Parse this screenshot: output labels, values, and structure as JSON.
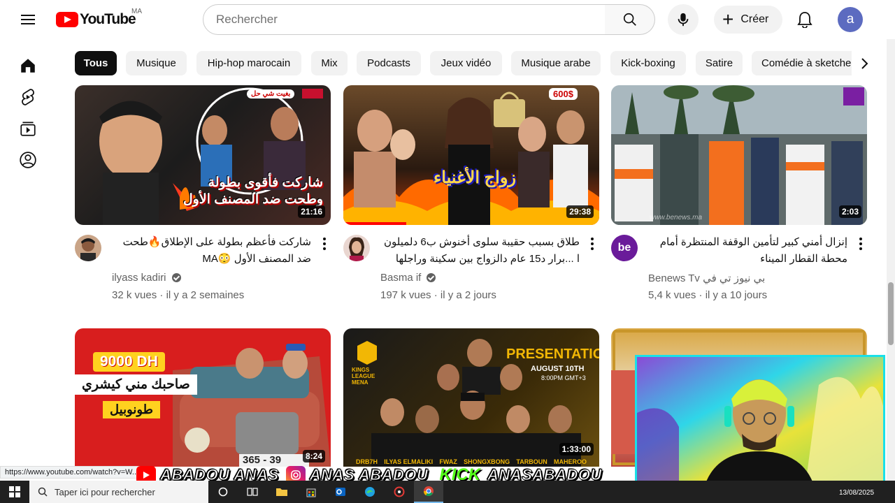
{
  "header": {
    "logo_text": "YouTube",
    "country_code": "MA",
    "search_placeholder": "Rechercher",
    "create_label": "Créer",
    "avatar_letter": "a"
  },
  "sidebar": {
    "items": [
      {
        "icon": "home-icon"
      },
      {
        "icon": "shorts-icon"
      },
      {
        "icon": "subscriptions-icon"
      },
      {
        "icon": "you-icon"
      }
    ]
  },
  "chips": [
    {
      "label": "Tous",
      "active": true
    },
    {
      "label": "Musique"
    },
    {
      "label": "Hip-hop marocain"
    },
    {
      "label": "Mix"
    },
    {
      "label": "Podcasts"
    },
    {
      "label": "Jeux vidéo"
    },
    {
      "label": "Musique arabe"
    },
    {
      "label": "Kick-boxing"
    },
    {
      "label": "Satire"
    },
    {
      "label": "Comédie à sketche"
    }
  ],
  "videos": [
    {
      "duration": "21:16",
      "thumb_text_top": "بغيت شي حل",
      "thumb_text": "شاركت فأقوى بطولة وطحت ضد المصنف الأول",
      "title": "شاركت فأعظم بطولة على الإطلاق🔥طحت ضد المصنف الأول 😳MA",
      "channel": "ilyass kadiri",
      "verified": true,
      "views": "32 k vues",
      "age": "il y a 2 semaines"
    },
    {
      "duration": "29:38",
      "thumb_badge": "600$",
      "thumb_text": "زواج الأغنياء",
      "title": "طلاق بسبب حقيبة سلوى أخنوش ب6 دلميلون ا ...برار د15 عام دالزواج بين سكينة وراجلها وثروة",
      "channel": "Basma if",
      "verified": true,
      "views": "197 k vues",
      "age": "il y a 2 jours"
    },
    {
      "duration": "2:03",
      "thumb_watermark": "www.benews.ma",
      "title": "إنزال أمني كبير لتأمين الوقفة المنتظرة أمام محطة القطار الميناء",
      "channel": "Benews Tv بي نيوز تي في",
      "channel_avatar_text": "be",
      "verified": false,
      "views": "5,4 k vues",
      "age": "il y a 10 jours"
    },
    {
      "duration": "8:24",
      "thumb_badge": "9000 DH",
      "thumb_text": "صاحبك مني كيشري",
      "thumb_text2": "طونوبيل",
      "plate": "365 - 39"
    },
    {
      "duration": "1:33:00",
      "thumb_title": "PRESENTATION",
      "thumb_date": "AUGUST 10TH",
      "thumb_time": "8:00PM GMT+3",
      "thumb_logo": "KINGS LEAGUE MENA",
      "players": [
        "DRB7H",
        "ILYAS ELMALIKI",
        "FWAZ",
        "SHONGXBONG",
        "TARBOUN",
        "MAHEROO"
      ]
    },
    {
      "duration": ""
    }
  ],
  "status_url": "https://www.youtube.com/watch?v=W...",
  "overlay": {
    "name1": "ABADOU ANAS",
    "name2": "ANAS ABADOU",
    "kick_label": "KICK",
    "name3": "ANASABADOU"
  },
  "taskbar": {
    "search_placeholder": "Taper ici pour rechercher",
    "date": "13/08/2025"
  },
  "colors": {
    "brand_red": "#ff0000",
    "chip_active_bg": "#0f0f0f",
    "kick_green": "#53fc18",
    "webcam_border": "#19e0e8"
  }
}
